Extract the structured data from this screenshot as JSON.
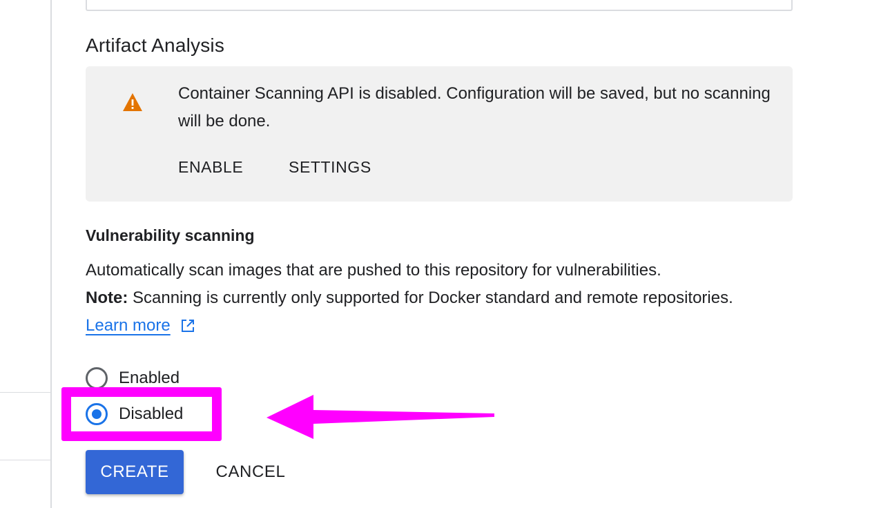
{
  "artifact_analysis": {
    "title": "Artifact Analysis",
    "warning": {
      "icon": "warning-icon",
      "message": "Container Scanning API is disabled. Configuration will be saved, but no scanning will be done.",
      "enable_label": "ENABLE",
      "settings_label": "SETTINGS"
    }
  },
  "vulnerability_scanning": {
    "title": "Vulnerability scanning",
    "description": "Automatically scan images that are pushed to this repository for vulnerabilities.",
    "note_label": "Note:",
    "note_text": " Scanning is currently only supported for Docker standard and remote repositories.",
    "learn_more_label": "Learn more",
    "options": [
      {
        "label": "Enabled",
        "selected": false
      },
      {
        "label": "Disabled",
        "selected": true
      }
    ]
  },
  "actions": {
    "create_label": "CREATE",
    "cancel_label": "CANCEL"
  },
  "colors": {
    "primary": "#1a73e8",
    "button_primary": "#3367d6",
    "warning": "#e37400",
    "annotation": "#ff00ff"
  }
}
